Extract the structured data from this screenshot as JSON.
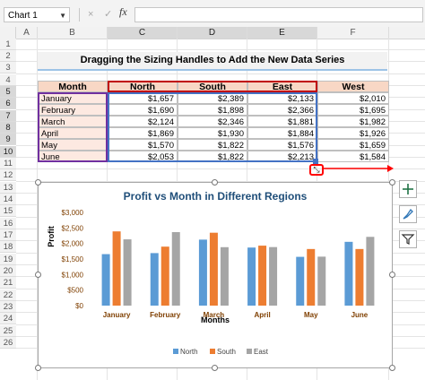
{
  "formula_bar": {
    "name_box": "Chart 1",
    "cancel_icon": "×",
    "enter_icon": "✓",
    "fx_label": "fx",
    "formula": ""
  },
  "columns": [
    "A",
    "B",
    "C",
    "D",
    "E",
    "F"
  ],
  "rows": [
    "1",
    "2",
    "3",
    "4",
    "5",
    "6",
    "7",
    "8",
    "9",
    "10",
    "11",
    "12",
    "13",
    "14",
    "15",
    "16",
    "17",
    "18",
    "19",
    "20",
    "21",
    "22",
    "23",
    "24",
    "25",
    "26"
  ],
  "title": "Dragging the Sizing Handles to Add the New Data Series",
  "table": {
    "headers": [
      "Month",
      "North",
      "South",
      "East",
      "West"
    ],
    "rows": [
      [
        "January",
        "$1,657",
        "$2,389",
        "$2,133",
        "$2,010"
      ],
      [
        "February",
        "$1,690",
        "$1,898",
        "$2,366",
        "$1,695"
      ],
      [
        "March",
        "$2,124",
        "$2,346",
        "$1,881",
        "$1,982"
      ],
      [
        "April",
        "$1,869",
        "$1,930",
        "$1,884",
        "$1,926"
      ],
      [
        "May",
        "$1,570",
        "$1,822",
        "$1,576",
        "$1,659"
      ],
      [
        "June",
        "$2,053",
        "$1,822",
        "$2,213",
        "$1,584"
      ]
    ]
  },
  "colors": {
    "north": "#5b9bd5",
    "south": "#ed7d31",
    "east": "#a5a5a5",
    "chart_title": "#1f4e79",
    "selection_purple": "#7030a0",
    "selection_blue": "#4472c4",
    "selection_red": "#c00000",
    "axis_label": "#7f3f00",
    "sidebar_icon": "#217346"
  },
  "side_buttons": {
    "elements_icon": "plus-icon",
    "styles_icon": "brush-icon",
    "filters_icon": "filter-icon"
  },
  "chart_data": {
    "type": "bar",
    "title": "Profit vs Month in Different Regions",
    "xlabel": "Months",
    "ylabel": "Profit",
    "categories": [
      "January",
      "February",
      "March",
      "April",
      "May",
      "June"
    ],
    "ylim": [
      0,
      3000
    ],
    "yticks": [
      "$0",
      "$500",
      "$1,000",
      "$1,500",
      "$2,000",
      "$2,500",
      "$3,000"
    ],
    "ytick_values": [
      0,
      500,
      1000,
      1500,
      2000,
      2500,
      3000
    ],
    "grid": false,
    "legend_position": "bottom",
    "series": [
      {
        "name": "North",
        "values": [
          1657,
          1690,
          2124,
          1869,
          1570,
          2053
        ]
      },
      {
        "name": "South",
        "values": [
          2389,
          1898,
          2346,
          1930,
          1822,
          1822
        ]
      },
      {
        "name": "East",
        "values": [
          2133,
          2366,
          1881,
          1884,
          1576,
          2213
        ]
      }
    ]
  }
}
